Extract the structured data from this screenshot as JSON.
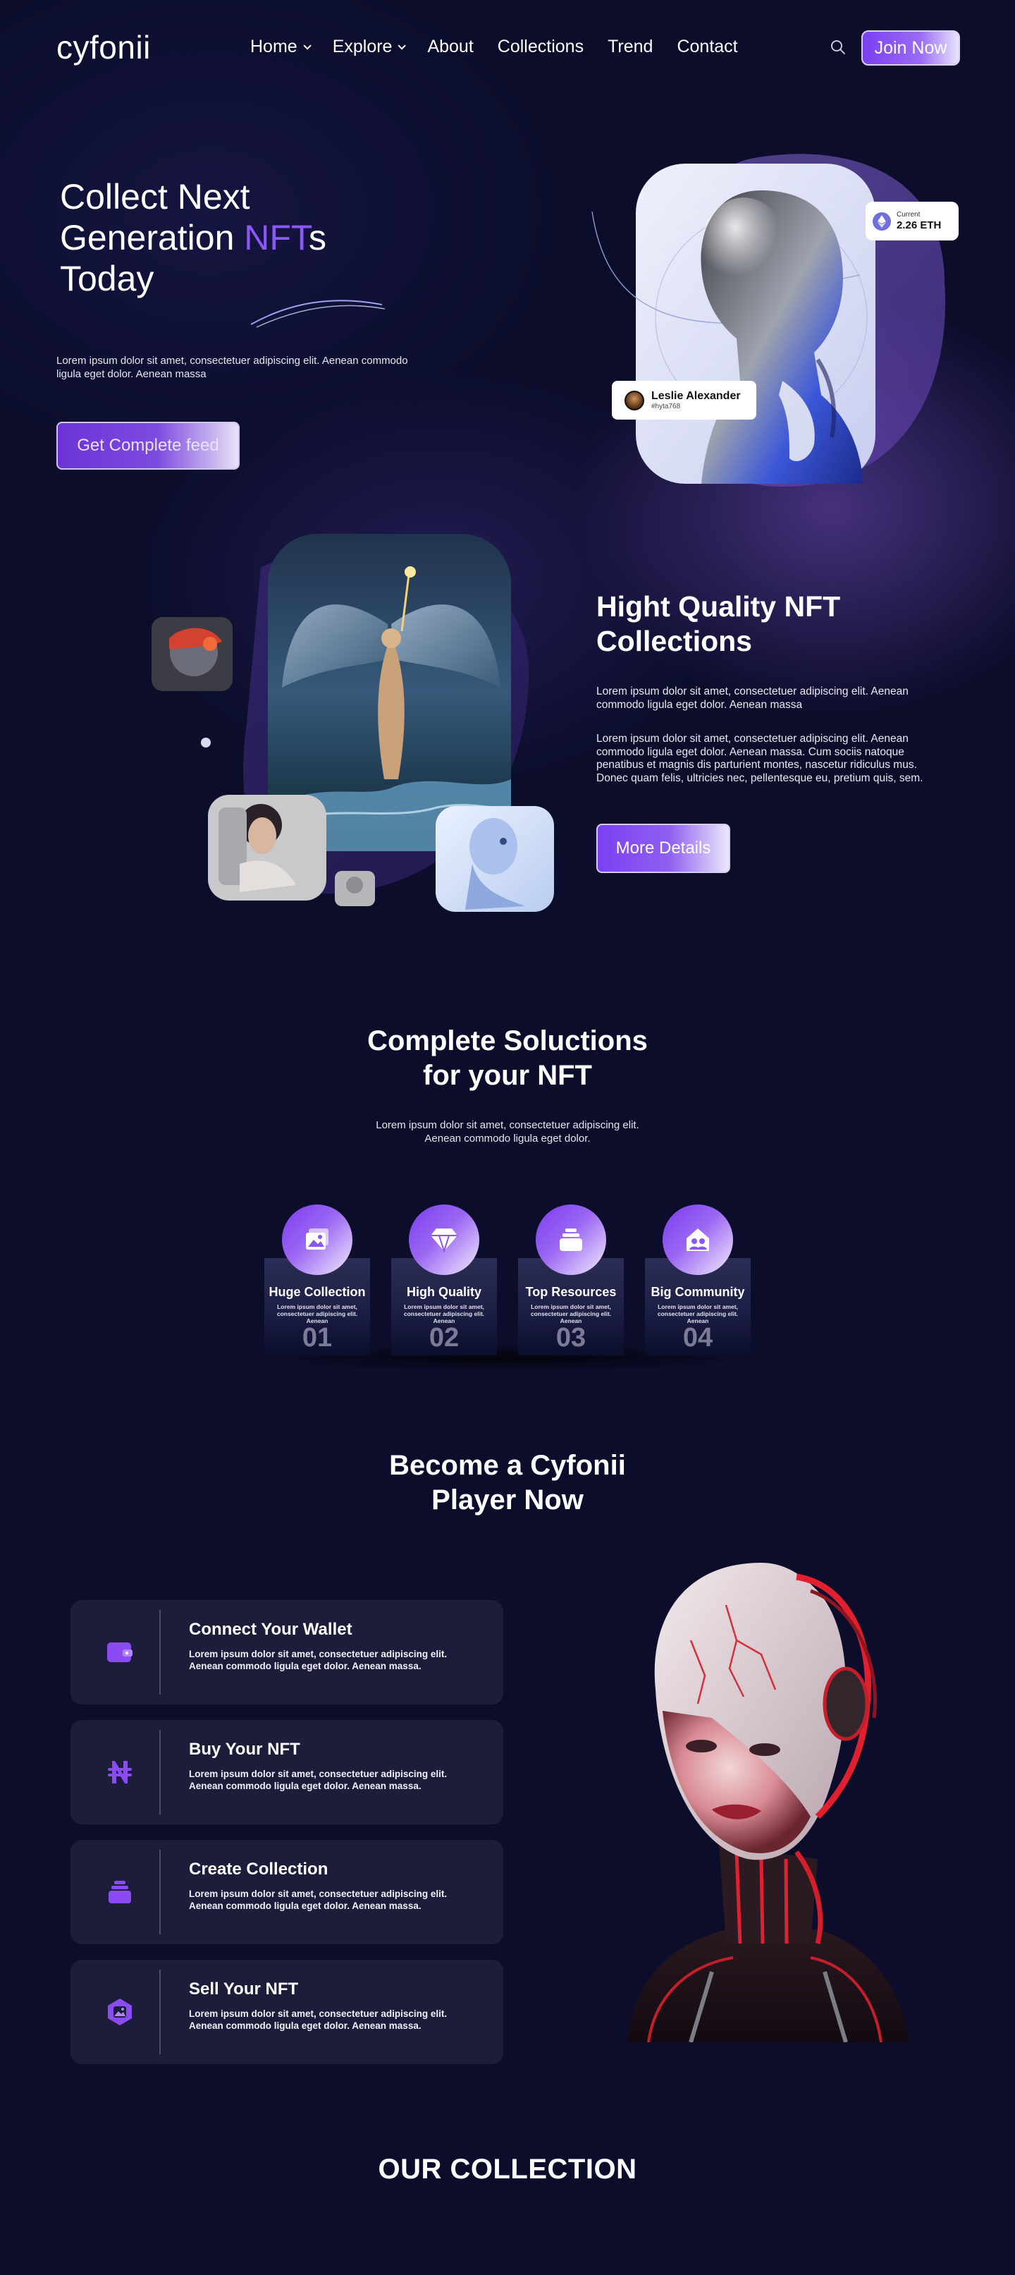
{
  "header": {
    "logo": "cyfonii",
    "nav": [
      {
        "label": "Home",
        "dropdown": true
      },
      {
        "label": "Explore",
        "dropdown": true
      },
      {
        "label": "About",
        "dropdown": false
      },
      {
        "label": "Collections",
        "dropdown": false
      },
      {
        "label": "Trend",
        "dropdown": false
      },
      {
        "label": "Contact",
        "dropdown": false
      }
    ],
    "join_label": "Join Now"
  },
  "hero": {
    "title_line1": "Collect Next",
    "title_line2_pre": "Generation ",
    "title_line2_accent": "NFT",
    "title_line2_post": "s",
    "title_line3": "Today",
    "description": "Lorem ipsum dolor sit amet, consectetuer adipiscing elit. Aenean commodo ligula eget dolor. Aenean massa",
    "cta_label": "Get Complete feed",
    "eth_card": {
      "label": "Current",
      "value": "2.26 ETH"
    },
    "user_card": {
      "name": "Leslie Alexander",
      "handle": "#hyta768"
    }
  },
  "quality": {
    "title": "Hight Quality NFT Collections",
    "paragraph1": "Lorem ipsum dolor sit amet, consectetuer adipiscing elit. Aenean commodo ligula eget dolor. Aenean massa",
    "paragraph2": "Lorem ipsum dolor sit amet, consectetuer adipiscing elit. Aenean commodo ligula eget dolor. Aenean massa. Cum sociis natoque penatibus et magnis dis parturient montes, nascetur ridiculus mus. Donec quam felis, ultricies nec, pellentesque eu, pretium quis, sem.",
    "cta_label": "More Details"
  },
  "solutions": {
    "title_line1": "Complete Soluctions",
    "title_line2": "for your NFT",
    "description_line1": "Lorem ipsum dolor sit amet, consectetuer adipiscing elit.",
    "description_line2": "Aenean commodo ligula eget dolor.",
    "features": [
      {
        "icon": "image-gallery-icon",
        "title": "Huge Collection",
        "desc": "Lorem ipsum dolor sit amet, consectetuer adipiscing elit. Aenean",
        "num": "01"
      },
      {
        "icon": "diamond-icon",
        "title": "High Quality",
        "desc": "Lorem ipsum dolor sit amet, consectetuer adipiscing elit. Aenean",
        "num": "02"
      },
      {
        "icon": "stack-icon",
        "title": "Top Resources",
        "desc": "Lorem ipsum dolor sit amet, consectetuer adipiscing elit. Aenean",
        "num": "03"
      },
      {
        "icon": "community-icon",
        "title": "Big Community",
        "desc": "Lorem ipsum dolor sit amet, consectetuer adipiscing elit. Aenean",
        "num": "04"
      }
    ]
  },
  "player": {
    "title_line1": "Become a Cyfonii",
    "title_line2": "Player Now",
    "steps": [
      {
        "icon": "wallet-icon",
        "title": "Connect Your Wallet",
        "desc": "Lorem ipsum dolor sit amet, consectetuer adipiscing elit. Aenean commodo ligula eget dolor. Aenean massa."
      },
      {
        "icon": "naira-icon",
        "title": "Buy Your NFT",
        "desc": "Lorem ipsum dolor sit amet, consectetuer adipiscing elit. Aenean commodo ligula eget dolor. Aenean massa."
      },
      {
        "icon": "collection-stack-icon",
        "title": "Create Collection",
        "desc": "Lorem ipsum dolor sit amet, consectetuer adipiscing elit. Aenean commodo ligula eget dolor. Aenean massa."
      },
      {
        "icon": "nft-hexagon-icon",
        "title": "Sell Your NFT",
        "desc": "Lorem ipsum dolor sit amet, consectetuer adipiscing elit. Aenean commodo ligula eget dolor. Aenean massa."
      }
    ]
  },
  "collection": {
    "title": "OUR COLLECTION"
  },
  "colors": {
    "background": "#0b0d2b",
    "accent": "#7b3ff2",
    "card": "#1c1d3a"
  }
}
